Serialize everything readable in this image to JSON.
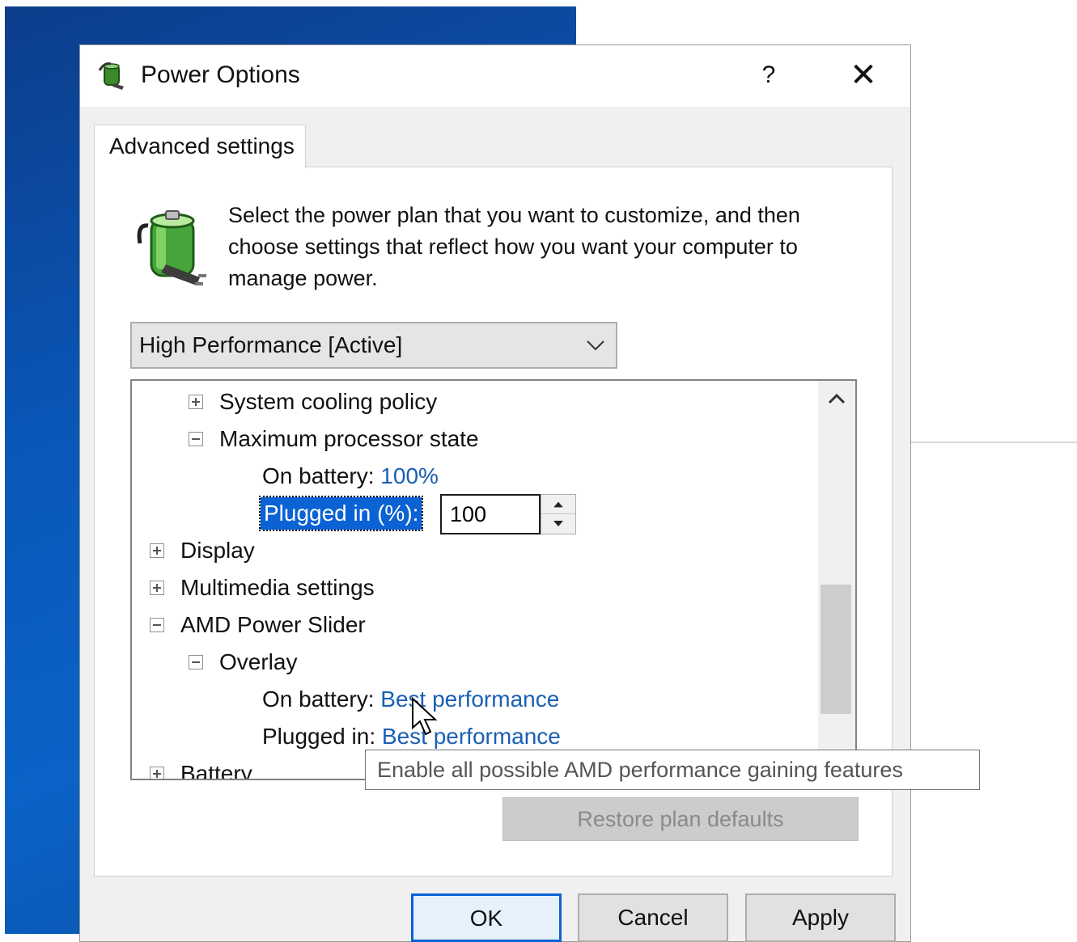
{
  "window": {
    "title": "Power Options",
    "help_label": "?",
    "close_label": "✕"
  },
  "tab": {
    "label": "Advanced settings"
  },
  "description": "Select the power plan that you want to customize, and then choose settings that reflect how you want your computer to manage power.",
  "plan_select": {
    "value": "High Performance [Active]"
  },
  "tree": {
    "system_cooling": "System cooling policy",
    "max_processor": "Maximum processor state",
    "on_battery_label": "On battery:",
    "on_battery_value": "100%",
    "plugged_label": "Plugged in (%):",
    "plugged_value": "100",
    "display": "Display",
    "multimedia": "Multimedia settings",
    "amd_slider": "AMD Power Slider",
    "overlay": "Overlay",
    "overlay_battery_label": "On battery:",
    "overlay_battery_value": "Best performance",
    "overlay_plugged_label": "Plugged in:",
    "overlay_plugged_value": "Best performance",
    "battery": "Battery"
  },
  "tooltip": "Enable all possible AMD performance gaining features",
  "buttons": {
    "restore": "Restore plan defaults",
    "ok": "OK",
    "cancel": "Cancel",
    "apply": "Apply"
  },
  "colors": {
    "selection": "#0a62d4",
    "link": "#1a5fb4",
    "wallpaper": "#0a57b8"
  }
}
